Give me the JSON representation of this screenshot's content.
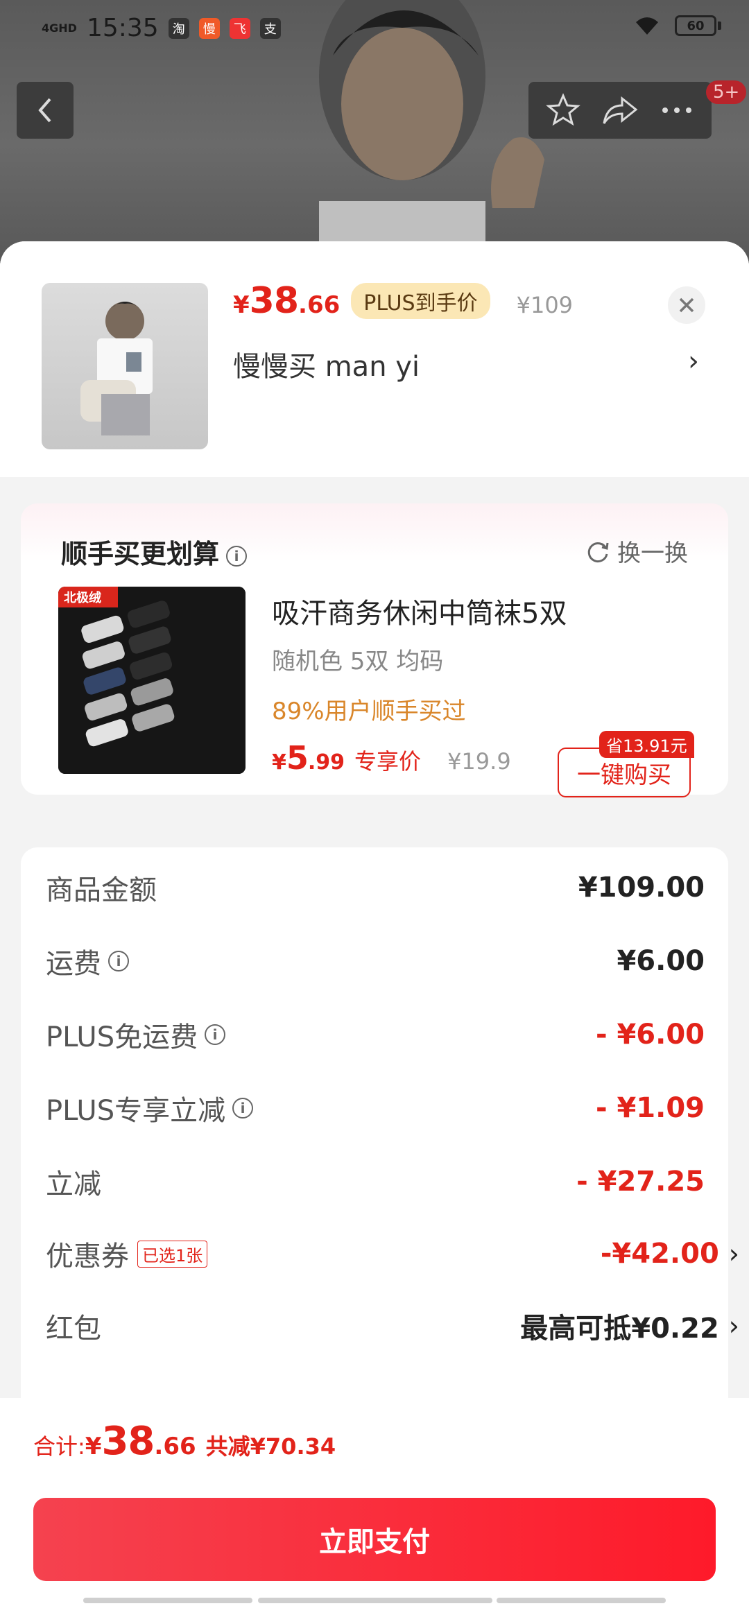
{
  "status_bar": {
    "time": "15:35",
    "network": "4GHD",
    "battery": "60",
    "app_icons": [
      "淘",
      "慢",
      "飞",
      "支"
    ]
  },
  "top_nav": {
    "back_icon": "chevron-left-icon",
    "favorite_icon": "star-icon",
    "share_icon": "share-icon",
    "more_icon": "more-icon",
    "badge": "5+"
  },
  "product": {
    "price_currency": "¥",
    "price_int": "38",
    "price_dec": ".66",
    "plus_tag": "PLUS到手价",
    "original_price": "¥109",
    "shop_name": "慢慢买  man yi",
    "arrow": "›"
  },
  "upsell": {
    "title": "顺手买更划算",
    "swap_label": "换一换",
    "item_name": "吸汗商务休闲中筒袜5双",
    "item_spec": "随机色 5双   均码",
    "bought_text": "89%用户顺手买过",
    "price_currency": "¥",
    "price_int": "5",
    "price_dec": ".99",
    "price_label": "专享价",
    "original_price": "¥19.9",
    "save_tag": "省13.91元",
    "buy_button": "一键购买",
    "brand_logo_text": "北极绒"
  },
  "summary": {
    "rows": [
      {
        "label": "商品金额",
        "value": "¥109.00"
      },
      {
        "label": "运费",
        "value": "¥6.00"
      },
      {
        "label": "PLUS免运费",
        "value": "- ¥6.00"
      },
      {
        "label": "PLUS专享立减",
        "value": "- ¥1.09"
      },
      {
        "label": "立减",
        "value": "- ¥27.25"
      },
      {
        "label": "优惠券",
        "tag": "已选1张",
        "value": "-¥42.00"
      },
      {
        "label": "红包",
        "value": "最高可抵¥0.22"
      }
    ]
  },
  "footer": {
    "total_label": "合计:",
    "currency": "¥",
    "total_int": "38",
    "total_dec": ".66",
    "saved": "共减¥70.34",
    "pay_button": "立即支付"
  },
  "colors": {
    "accent_red": "#e2231a",
    "plus_gold": "#fbe7b5",
    "bought_orange": "#d9862a"
  }
}
